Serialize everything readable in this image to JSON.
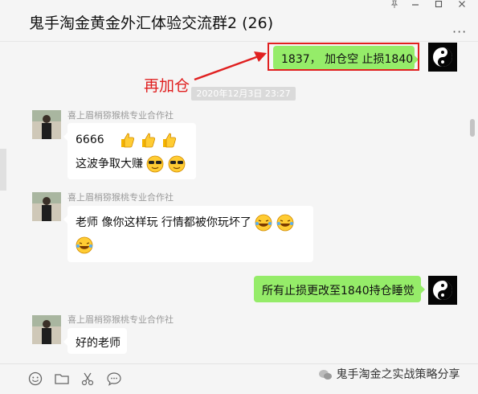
{
  "window": {
    "title": "鬼手淘金黄金外汇体验交流群2 (26)",
    "pin_icon": "pin-icon",
    "minimize_icon": "minimize-icon",
    "maximize_icon": "maximize-icon",
    "close_icon": "close-icon",
    "more_label": "···"
  },
  "messages": {
    "m1": {
      "text": "1837， 加仓空  止损1840"
    },
    "timestamp": "2020年12月3日 23:27",
    "m2": {
      "sender": "喜上眉梢猕猴桃专业合作社",
      "line1": "6666",
      "line2": "这波争取大赚"
    },
    "m3": {
      "sender": "喜上眉梢猕猴桃专业合作社",
      "line1": "老师  像你这样玩   行情都被你玩坏了"
    },
    "m4": {
      "text": "所有止损更改至1840持仓睡觉"
    },
    "m5": {
      "sender": "喜上眉梢猕猴桃专业合作社",
      "line1": "好的老师"
    }
  },
  "annotation": {
    "label": "再加仓",
    "color": "#e02020"
  },
  "toolbar": {
    "icons": [
      "emoji-icon",
      "folder-icon",
      "scissors-icon",
      "chat-bubble-icon"
    ]
  },
  "watermark": {
    "text": "鬼手淘金之实战策略分享"
  },
  "colors": {
    "green_bubble": "#95ec69",
    "white_bubble": "#ffffff",
    "background": "#f5f5f5",
    "accent_red": "#e02020"
  }
}
